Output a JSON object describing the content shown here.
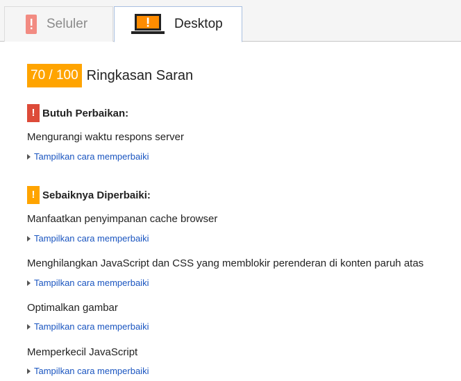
{
  "tabs": {
    "mobile": {
      "label": "Seluler",
      "icon": "phone-warning-icon"
    },
    "desktop": {
      "label": "Desktop",
      "icon": "laptop-warning-icon"
    }
  },
  "summary": {
    "score": "70 / 100",
    "title": "Ringkasan Saran"
  },
  "groups": [
    {
      "badge": "!",
      "title": "Butuh Perbaikan:",
      "color": "#dd4b39",
      "rules": [
        {
          "title": "Mengurangi waktu respons server",
          "link": "Tampilkan cara memperbaiki"
        }
      ]
    },
    {
      "badge": "!",
      "title": "Sebaiknya Diperbaiki:",
      "color": "#ffa400",
      "rules": [
        {
          "title": "Manfaatkan penyimpanan cache browser",
          "link": "Tampilkan cara memperbaiki"
        },
        {
          "title": "Menghilangkan JavaScript dan CSS yang memblokir perenderan di konten paruh atas",
          "link": "Tampilkan cara memperbaiki"
        },
        {
          "title": "Optimalkan gambar",
          "link": "Tampilkan cara memperbaiki"
        },
        {
          "title": "Memperkecil JavaScript",
          "link": "Tampilkan cara memperbaiki"
        }
      ]
    }
  ]
}
